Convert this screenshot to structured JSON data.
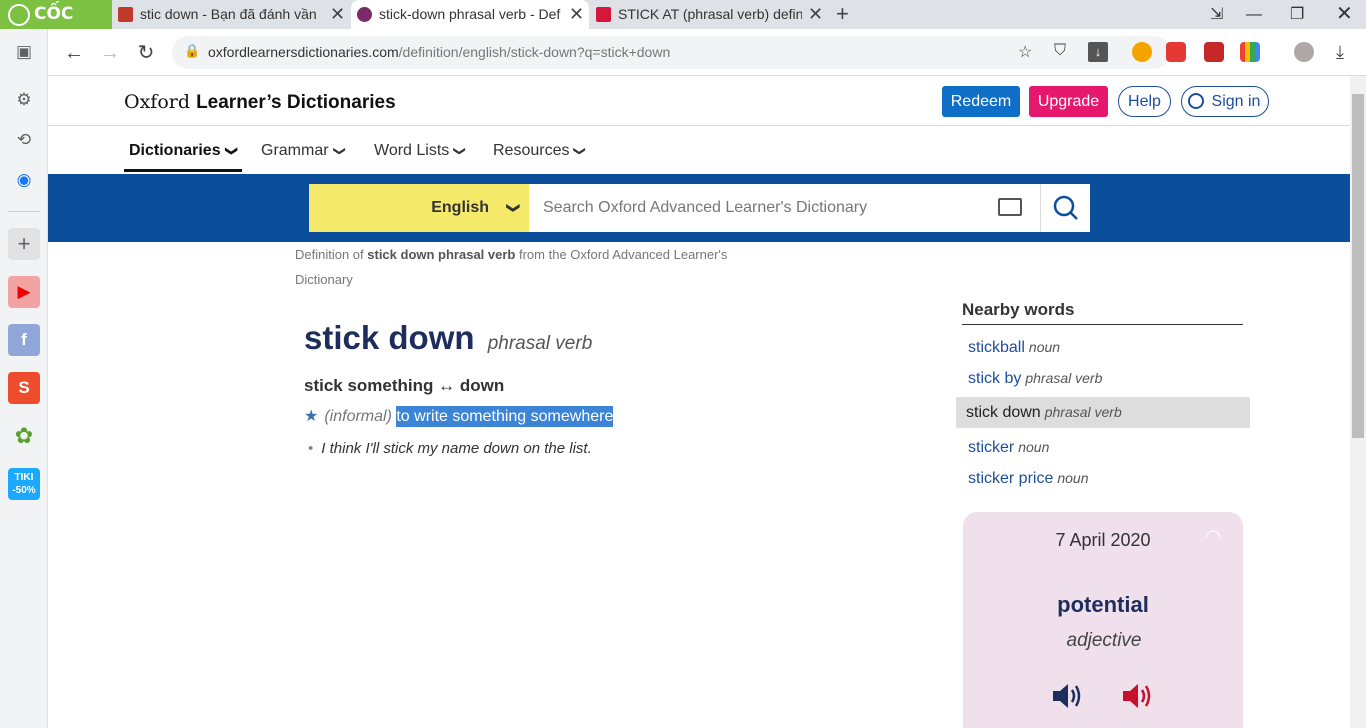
{
  "browser": {
    "brand": "CỐC CỐC",
    "tabs": [
      {
        "title": "stic down - Bạn đã đánh vần s",
        "close": "✕"
      },
      {
        "title": "stick-down phrasal verb - Def",
        "close": "✕"
      },
      {
        "title": "STICK AT (phrasal verb) definit",
        "close": "✕"
      }
    ],
    "new_tab": "+",
    "url_domain": "oxfordlearnersdictionaries.com",
    "url_path": "/definition/english/stick-down?q=stick+down"
  },
  "site": {
    "logo_regular": "Oxford ",
    "logo_bold": "Learner’s Dictionaries",
    "redeem": "Redeem",
    "upgrade": "Upgrade",
    "help": "Help",
    "signin": "Sign in",
    "nav": [
      "Dictionaries",
      "Grammar",
      "Word Lists",
      "Resources"
    ]
  },
  "search": {
    "language": "English",
    "placeholder": "Search Oxford Advanced Learner's Dictionary"
  },
  "breadcrumb": {
    "prefix": "Definition of ",
    "term": "stick down phrasal verb",
    "suffix": " from the Oxford Advanced Learner's Dictionary"
  },
  "entry": {
    "headword": "stick down",
    "pos": "phrasal verb",
    "phrasal": "stick something ↔ down",
    "label": "(informal)",
    "definition": "to write something somewhere",
    "example": "I think I'll stick my name down on the list."
  },
  "nearby": {
    "title": "Nearby words",
    "items": [
      {
        "word": "stickball",
        "pos": "noun"
      },
      {
        "word": "stick by",
        "pos": "phrasal verb"
      },
      {
        "word": "stick down",
        "pos": "phrasal verb"
      },
      {
        "word": "sticker",
        "pos": "noun"
      },
      {
        "word": "sticker price",
        "pos": "noun"
      }
    ]
  },
  "word_of_the_day": {
    "date": "7 April 2020",
    "word": "potential",
    "pos": "adjective"
  },
  "colors": {
    "brand_green": "#7cc142",
    "band_blue": "#0b4e9b",
    "redeem_blue": "#0f6fc6",
    "upgrade_pink": "#e6186d",
    "lang_yellow": "#f5e96a",
    "highlight": "#3b84d6",
    "wotd_bg": "#efe0ec"
  }
}
